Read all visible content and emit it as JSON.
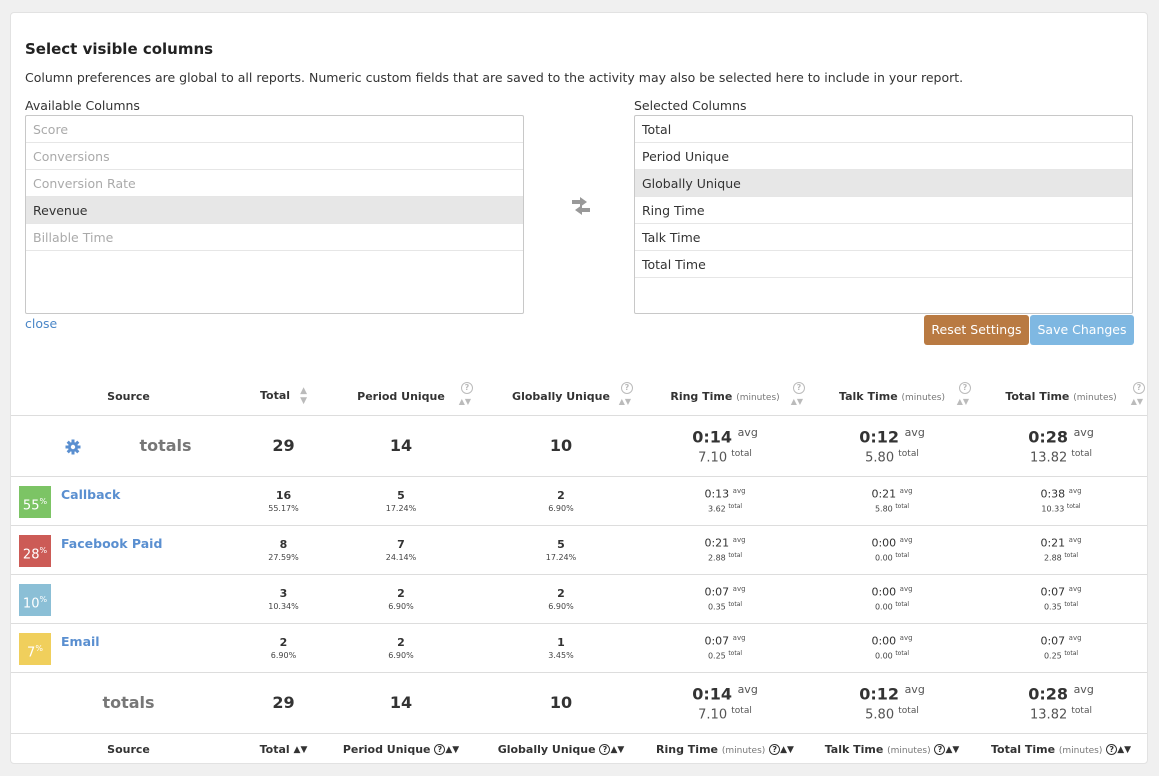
{
  "panel": {
    "title": "Select visible columns",
    "description": "Column preferences are global to all reports. Numeric custom fields that are saved to the activity may also be selected here to include in your report.",
    "available_label": "Available Columns",
    "selected_label": "Selected Columns",
    "available": [
      "Score",
      "Conversions",
      "Conversion Rate",
      "Revenue",
      "Billable Time"
    ],
    "selected": [
      "Total",
      "Period Unique",
      "Globally Unique",
      "Ring Time",
      "Talk Time",
      "Total Time"
    ],
    "close_label": "close",
    "reset_label": "Reset Settings",
    "save_label": "Save Changes"
  },
  "headers": {
    "source": "Source",
    "total": "Total",
    "period_unique": "Period Unique",
    "globally_unique": "Globally Unique",
    "ring_time": "Ring Time",
    "talk_time": "Talk Time",
    "total_time": "Total Time",
    "unit": "(minutes)"
  },
  "totals": {
    "label": "totals",
    "total": "29",
    "period_unique": "14",
    "globally_unique": "10",
    "ring_avg": "0:14",
    "ring_total": "7.10",
    "talk_avg": "0:12",
    "talk_total": "5.80",
    "time_avg": "0:28",
    "time_total": "13.82",
    "avg_word": "avg",
    "total_word": "total"
  },
  "rows": [
    {
      "pct": "55",
      "color": "#7cc465",
      "name": "Callback",
      "total": "16",
      "total_pct": "55.17%",
      "pu": "5",
      "pu_pct": "17.24%",
      "gu": "2",
      "gu_pct": "6.90%",
      "ring_avg": "0:13",
      "ring_total": "3.62",
      "talk_avg": "0:21",
      "talk_total": "5.80",
      "time_avg": "0:38",
      "time_total": "10.33"
    },
    {
      "pct": "28",
      "color": "#cc5b56",
      "name": "Facebook Paid",
      "total": "8",
      "total_pct": "27.59%",
      "pu": "7",
      "pu_pct": "24.14%",
      "gu": "5",
      "gu_pct": "17.24%",
      "ring_avg": "0:21",
      "ring_total": "2.88",
      "talk_avg": "0:00",
      "talk_total": "0.00",
      "time_avg": "0:21",
      "time_total": "2.88"
    },
    {
      "pct": "10",
      "color": "#8bbfd6",
      "name": "",
      "total": "3",
      "total_pct": "10.34%",
      "pu": "2",
      "pu_pct": "6.90%",
      "gu": "2",
      "gu_pct": "6.90%",
      "ring_avg": "0:07",
      "ring_total": "0.35",
      "talk_avg": "0:00",
      "talk_total": "0.00",
      "time_avg": "0:07",
      "time_total": "0.35"
    },
    {
      "pct": "7",
      "color": "#f0cf5c",
      "name": "Email",
      "total": "2",
      "total_pct": "6.90%",
      "pu": "2",
      "pu_pct": "6.90%",
      "gu": "1",
      "gu_pct": "3.45%",
      "ring_avg": "0:07",
      "ring_total": "0.25",
      "talk_avg": "0:00",
      "talk_total": "0.00",
      "time_avg": "0:07",
      "time_total": "0.25"
    }
  ],
  "pct_symbol": "%",
  "colors": {
    "link": "#4a86c7",
    "reset": "#b97a42",
    "save": "#7fb8e2",
    "gear": "#5a8fd0"
  }
}
